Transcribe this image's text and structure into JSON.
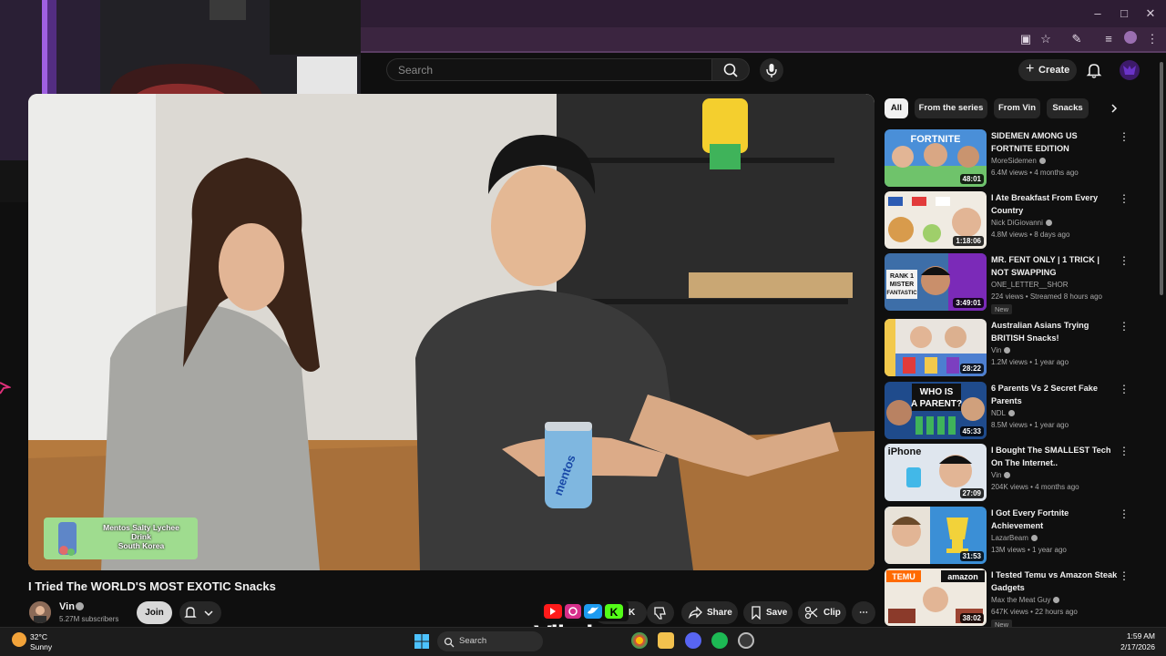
{
  "youtube": {
    "search_placeholder": "Search",
    "create_label": "Create"
  },
  "video": {
    "title": "I Tried The WORLD'S MOST EXOTIC Snacks",
    "caption_card": "Mentos Salty Lychee\nDrink\nSouth Korea",
    "can_label": "mentos"
  },
  "channel": {
    "name": "Vin",
    "subscribers": "5.27M subscribers",
    "join_label": "Join"
  },
  "actions": {
    "like_count_partial": "K",
    "share_label": "Share",
    "save_label": "Save",
    "clip_label": "Clip"
  },
  "overlay": {
    "brand": "Vibzlo"
  },
  "chips": [
    {
      "label": "All",
      "active": true
    },
    {
      "label": "From the series",
      "active": false
    },
    {
      "label": "From Vin",
      "active": false
    },
    {
      "label": "Snacks",
      "active": false
    }
  ],
  "recommendations": [
    {
      "title": "SIDEMEN AMONG US FORTNITE EDITION",
      "channel": "MoreSidemen",
      "meta": "6.4M views • 4 months ago",
      "duration": "48:01",
      "new": "",
      "verified": true,
      "thumb_label": "FORTNITE"
    },
    {
      "title": "I Ate Breakfast From Every Country",
      "channel": "Nick DiGiovanni",
      "meta": "4.8M views • 8 days ago",
      "duration": "1:18:06",
      "new": "",
      "verified": true,
      "thumb_label": ""
    },
    {
      "title": "MR. FENT ONLY | 1 TRICK | NOT SWAPPING",
      "channel": "ONE_LETTER__SHOR",
      "meta": "224 views • Streamed 8 hours ago",
      "duration": "3:49:01",
      "new": "New",
      "verified": false,
      "thumb_label": "RANK 1\nMISTER\nFANTASTIC"
    },
    {
      "title": "Australian Asians Trying BRITISH Snacks!",
      "channel": "Vin",
      "meta": "1.2M views • 1 year ago",
      "duration": "28:22",
      "new": "",
      "verified": true,
      "thumb_label": ""
    },
    {
      "title": "6 Parents Vs 2 Secret Fake Parents",
      "channel": "NDL",
      "meta": "8.5M views • 1 year ago",
      "duration": "45:33",
      "new": "",
      "verified": true,
      "thumb_label": "WHO IS\nA PARENT?"
    },
    {
      "title": "I Bought The SMALLEST Tech On The Internet..",
      "channel": "Vin",
      "meta": "204K views • 4 months ago",
      "duration": "27:09",
      "new": "",
      "verified": true,
      "thumb_label": "iPhone"
    },
    {
      "title": "I Got Every Fortnite Achievement",
      "channel": "LazarBeam",
      "meta": "13M views • 1 year ago",
      "duration": "31:53",
      "new": "",
      "verified": true,
      "thumb_label": ""
    },
    {
      "title": "I Tested Temu vs Amazon Steak Gadgets",
      "channel": "Max the Meat Guy",
      "meta": "647K views • 22 hours ago",
      "duration": "38:02",
      "new": "New",
      "verified": true,
      "thumb_label": "TEMU amazon"
    }
  ],
  "taskbar": {
    "temperature": "32°C",
    "condition": "Sunny",
    "search_label": "Search",
    "time": "1:59 AM",
    "date": "2/17/2026"
  }
}
